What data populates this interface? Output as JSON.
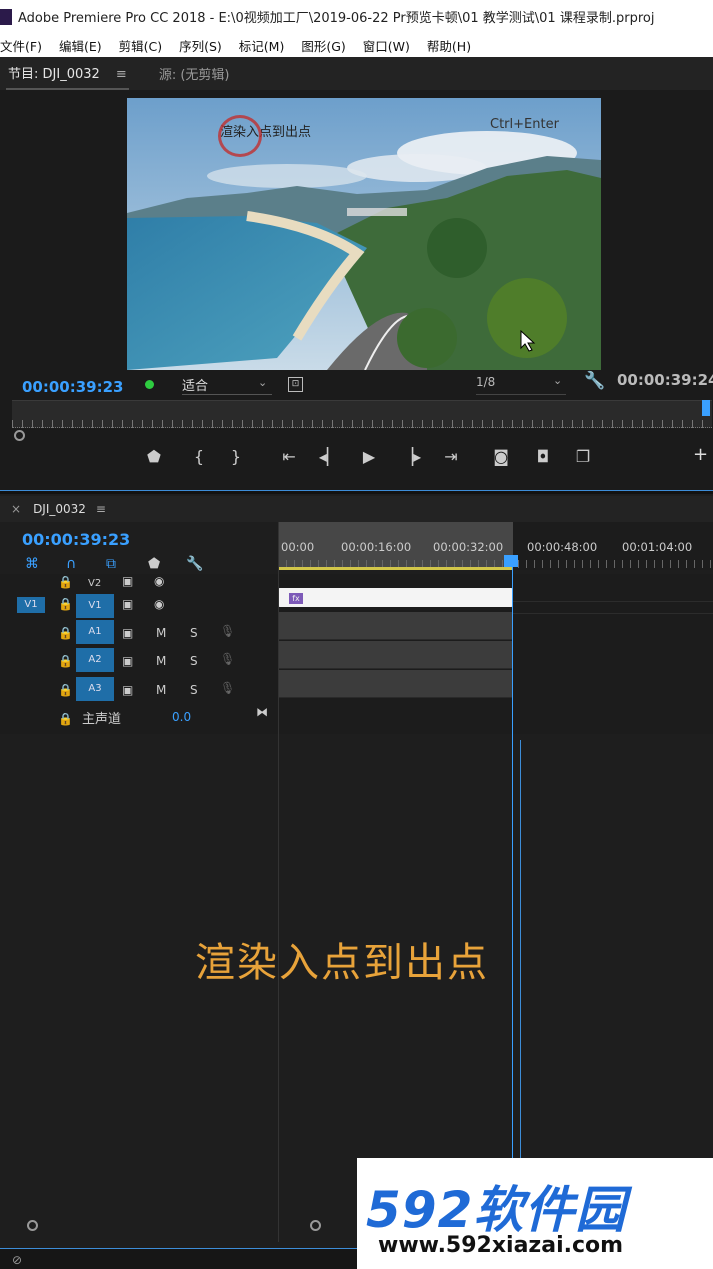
{
  "window": {
    "title": "Adobe Premiere Pro CC 2018 - E:\\0视频加工厂\\2019-06-22 Pr预览卡顿\\01 教学测试\\01 课程录制.prproj"
  },
  "menu": [
    "文件(F)",
    "编辑(E)",
    "剪辑(C)",
    "序列(S)",
    "标记(M)",
    "图形(G)",
    "窗口(W)",
    "帮助(H)"
  ],
  "monitor": {
    "program_tab": "节目: DJI_0032",
    "menu_glyph": "≡",
    "source_tab": "源: (无剪辑)",
    "video_overlay_left": "渲染入点到出点",
    "video_overlay_right": "Ctrl+Enter",
    "timecode_current": "00:00:39:23",
    "zoom_label": "适合",
    "resolution_label": "1/8",
    "timecode_duration": "00:00:39:24",
    "transport": [
      "marker",
      "mark-in",
      "mark-out",
      "go-to-in",
      "step-back",
      "play",
      "step-forward",
      "go-to-out",
      "insert",
      "export-frame",
      "compare"
    ]
  },
  "timeline": {
    "tab_label": "DJI_0032",
    "timecode": "00:00:39:23",
    "ruler": [
      "00:00",
      "00:00:16:00",
      "00:00:32:00",
      "00:00:48:00",
      "00:01:04:00"
    ],
    "video_tracks": [
      {
        "name": "V2",
        "source": ""
      },
      {
        "name": "V1",
        "source": "V1"
      }
    ],
    "audio_tracks": [
      {
        "name": "A1",
        "m": "M",
        "s": "S"
      },
      {
        "name": "A2",
        "m": "M",
        "s": "S"
      },
      {
        "name": "A3",
        "m": "M",
        "s": "S"
      }
    ],
    "master_label": "主声道",
    "master_value": "0.0",
    "clip_fx": "fx"
  },
  "caption": "渲染入点到出点",
  "watermark": {
    "logo": "592软件园",
    "url": "www.592xiazai.com"
  },
  "colors": {
    "accent": "#3aa0ff",
    "caption": "#e8a33a",
    "track_blue": "#1f6ea8",
    "work_bar": "#d2c64a"
  }
}
